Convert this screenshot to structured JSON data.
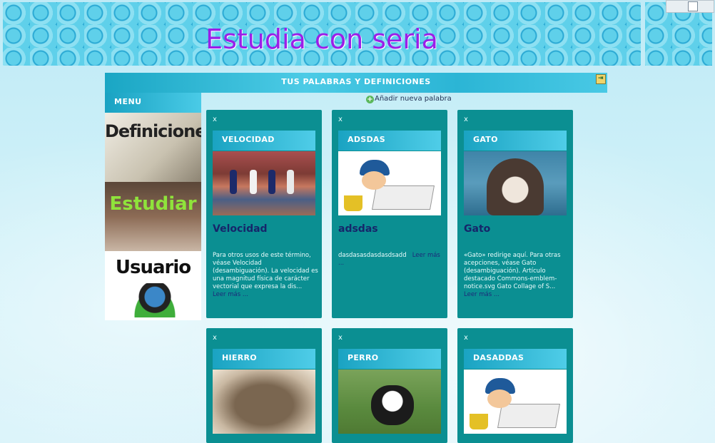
{
  "site": {
    "title": "Estudia con seria"
  },
  "section": {
    "title": "TUS PALABRAS Y DEFINICIONES"
  },
  "sidebar": {
    "heading": "MENU",
    "items": [
      {
        "label": "Definiciones"
      },
      {
        "label": "Estudiar"
      },
      {
        "label": "Usuario"
      }
    ]
  },
  "actions": {
    "add_word": "Añadir nueva palabra"
  },
  "cards": [
    {
      "close": "x",
      "header": "VELOCIDAD",
      "title": "Velocidad",
      "description": "Para otros usos de este término, véase Velocidad (desambiguación). La velocidad es una magnitud física de carácter vectorial que expresa la dis...",
      "read_more": "Leer más ..."
    },
    {
      "close": "x",
      "header": "ADSDAS",
      "title": "adsdas",
      "description": "dasdasasdasdasdsadd",
      "read_more": "Leer más ..."
    },
    {
      "close": "x",
      "header": "GATO",
      "title": "Gato",
      "description": "«Gato» redirige aquí. Para otras acepciones, véase Gato (desambiguación). Artículo destacado Commons-emblem-notice.svg Gato Collage of S...",
      "read_more": "Leer más ..."
    },
    {
      "close": "x",
      "header": "HIERRO"
    },
    {
      "close": "x",
      "header": "PERRO"
    },
    {
      "close": "x",
      "header": "DASADDAS"
    }
  ],
  "icons": {
    "logout": "logout-icon",
    "add": "plus-circle-icon",
    "plugin": "plugin-icon"
  }
}
